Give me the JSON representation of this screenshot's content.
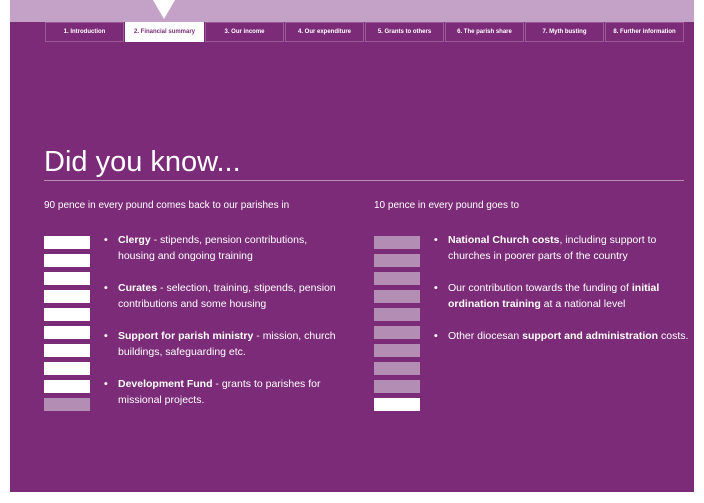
{
  "nav": {
    "tabs": [
      {
        "label": "1. Introduction",
        "active": false
      },
      {
        "label": "2. Financial summary",
        "active": true
      },
      {
        "label": "3. Our income",
        "active": false
      },
      {
        "label": "4. Our expenditure",
        "active": false
      },
      {
        "label": "5. Grants to others",
        "active": false
      },
      {
        "label": "6. The parish share",
        "active": false
      },
      {
        "label": "7. Myth busting",
        "active": false
      },
      {
        "label": "8. Further information",
        "active": false
      }
    ]
  },
  "main": {
    "title": "Did you know...",
    "left": {
      "intro": "90 pence in every pound comes back to our parishes in",
      "bars_filled": 9,
      "bars_total": 10,
      "items": [
        {
          "bold": "Clergy",
          "text": " - stipends, pension contributions, housing and ongoing training"
        },
        {
          "bold": "Curates",
          "text": " - selection, training, stipends, pension contributions and some housing"
        },
        {
          "bold": "Support for parish ministry",
          "text": " - mission, church buildings, safeguarding etc."
        },
        {
          "bold": "Development Fund",
          "text": " - grants to parishes for missional projects."
        }
      ]
    },
    "right": {
      "intro": "10 pence in every pound goes to",
      "bars_filled": 1,
      "bars_total": 10,
      "items": [
        {
          "pre": "",
          "bold": "National Church costs",
          "post": ", including support to churches in poorer parts of the country"
        },
        {
          "pre": "Our contribution towards the funding of ",
          "bold": "initial ordination training",
          "post": " at a national level"
        },
        {
          "pre": "Other diocesan ",
          "bold": "support and administration",
          "post": " costs."
        }
      ]
    }
  },
  "colors": {
    "panel": "#7b2b77",
    "band": "#c4a2c7",
    "bar_filled": "#ffffff",
    "bar_faded": "#b38db3"
  }
}
